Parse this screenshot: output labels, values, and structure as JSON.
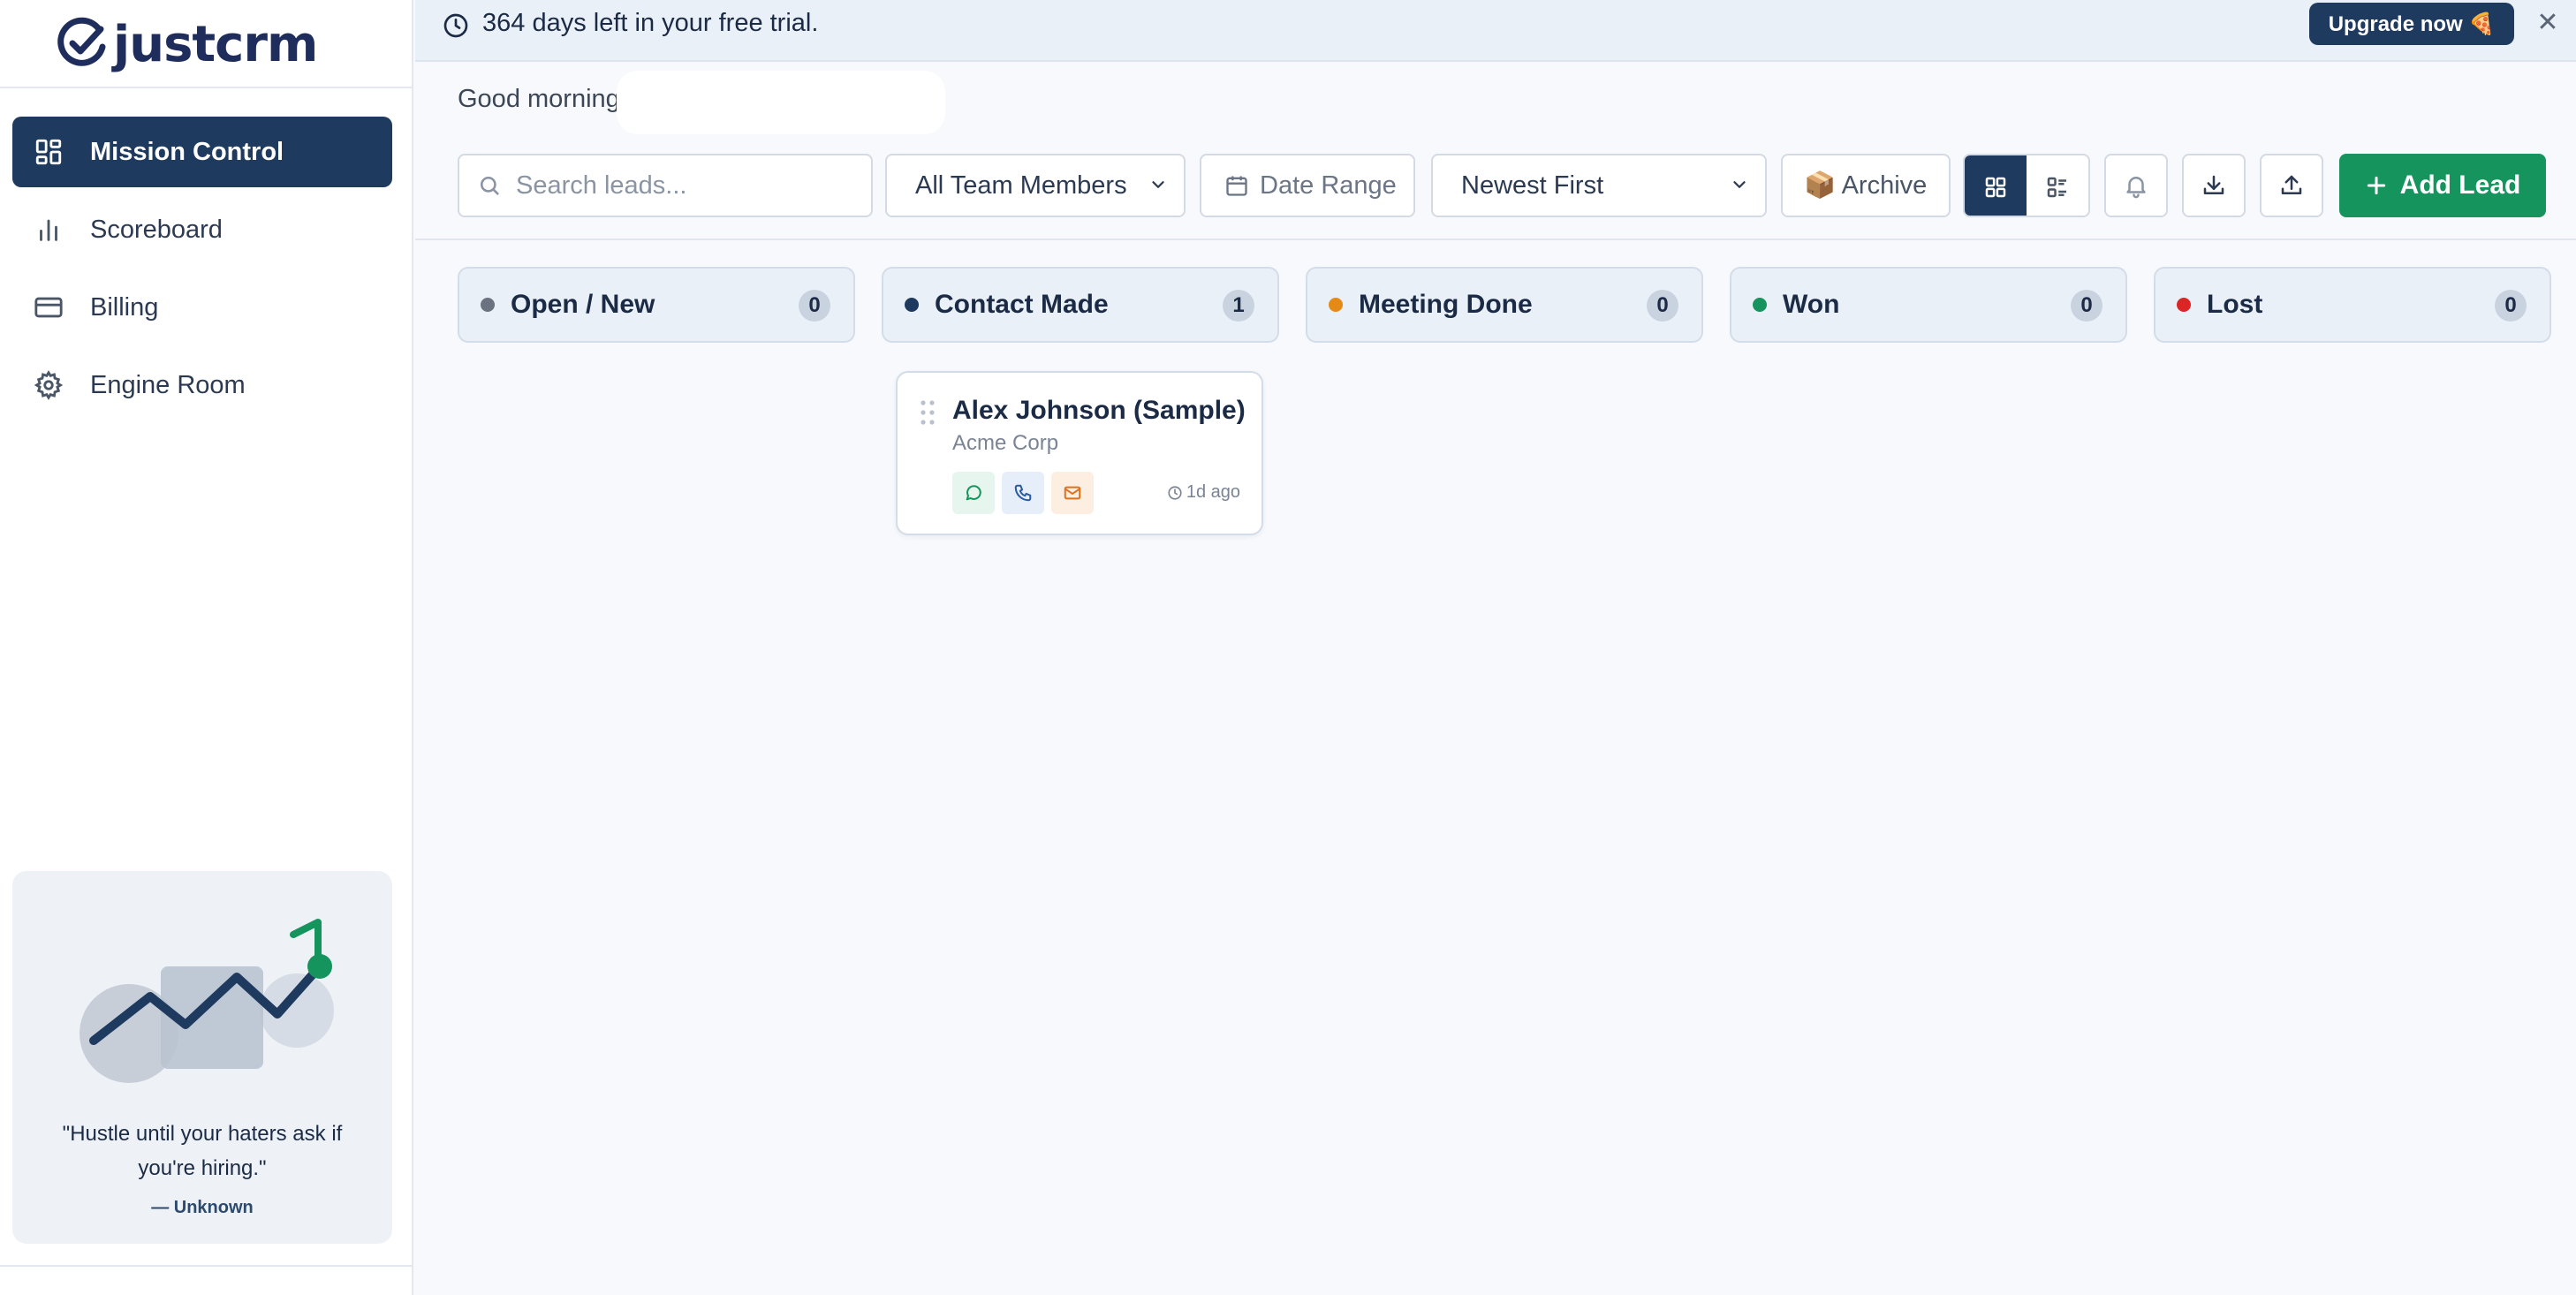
{
  "app": {
    "logo_text": "justcrm",
    "brand_color": "#1f3a5f",
    "accent_green": "#16945e"
  },
  "sidebar": {
    "items": [
      {
        "label": "Mission Control",
        "icon": "dashboard-grid-icon",
        "active": true
      },
      {
        "label": "Scoreboard",
        "icon": "bar-chart-icon",
        "active": false
      },
      {
        "label": "Billing",
        "icon": "credit-card-icon",
        "active": false
      },
      {
        "label": "Engine Room",
        "icon": "gear-icon",
        "active": false
      }
    ],
    "quote": {
      "text": "\"Hustle until your haters ask if you're hiring.\"",
      "author": "— Unknown"
    }
  },
  "banner": {
    "text": "364 days left in your free trial.",
    "upgrade_label": "Upgrade now 🍕",
    "close_glyph": "✕"
  },
  "greeting": {
    "text": "Good morning"
  },
  "toolbar": {
    "search_placeholder": "Search leads...",
    "team_filter": {
      "selected": "All Team Members"
    },
    "date_range_label": "Date Range",
    "sort": {
      "selected": "Newest First"
    },
    "archive_label": "📦 Archive",
    "add_lead_label": "Add Lead"
  },
  "board": {
    "columns": [
      {
        "title": "Open / New",
        "count": "0",
        "dot_color": "#6b7280"
      },
      {
        "title": "Contact Made",
        "count": "1",
        "dot_color": "#1f3a5f"
      },
      {
        "title": "Meeting Done",
        "count": "0",
        "dot_color": "#e58a17"
      },
      {
        "title": "Won",
        "count": "0",
        "dot_color": "#16945e"
      },
      {
        "title": "Lost",
        "count": "0",
        "dot_color": "#dc2626"
      }
    ],
    "cards": [
      {
        "name": "Alex Johnson (Sample)",
        "company": "Acme Corp",
        "time": "1d ago",
        "column": "Contact Made"
      }
    ]
  }
}
